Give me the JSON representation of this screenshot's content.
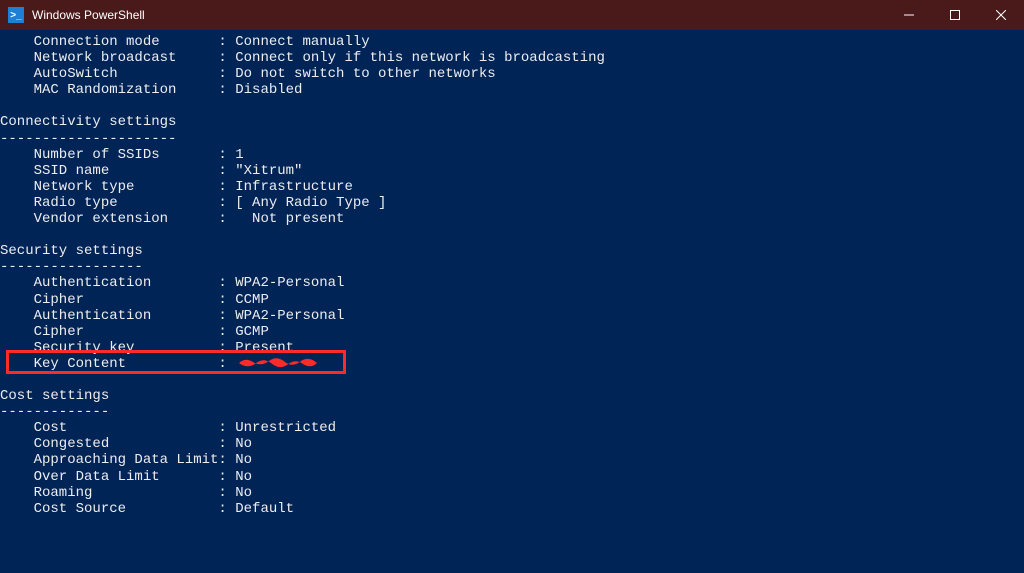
{
  "window": {
    "title": "Windows PowerShell",
    "icon_label": "powershell-icon"
  },
  "sections": {
    "top": [
      {
        "label": "Connection mode",
        "value": "Connect manually"
      },
      {
        "label": "Network broadcast",
        "value": "Connect only if this network is broadcasting"
      },
      {
        "label": "AutoSwitch",
        "value": "Do not switch to other networks"
      },
      {
        "label": "MAC Randomization",
        "value": "Disabled"
      }
    ],
    "connectivity_title": "Connectivity settings",
    "connectivity_dashes": "---------------------",
    "connectivity": [
      {
        "label": "Number of SSIDs",
        "value": "1"
      },
      {
        "label": "SSID name",
        "value": "\"Xitrum\""
      },
      {
        "label": "Network type",
        "value": "Infrastructure"
      },
      {
        "label": "Radio type",
        "value": "[ Any Radio Type ]"
      },
      {
        "label": "Vendor extension",
        "value": "Not present",
        "extra_value_pad": true
      }
    ],
    "security_title": "Security settings",
    "security_dashes": "-----------------",
    "security": [
      {
        "label": "Authentication",
        "value": "WPA2-Personal"
      },
      {
        "label": "Cipher",
        "value": "CCMP"
      },
      {
        "label": "Authentication",
        "value": "WPA2-Personal"
      },
      {
        "label": "Cipher",
        "value": "GCMP"
      },
      {
        "label": "Security key",
        "value": "Present"
      },
      {
        "label": "Key Content",
        "value": "",
        "redacted": true
      }
    ],
    "cost_title": "Cost settings",
    "cost_dashes": "-------------",
    "cost": [
      {
        "label": "Cost",
        "value": "Unrestricted"
      },
      {
        "label": "Congested",
        "value": "No"
      },
      {
        "label": "Approaching Data Limit",
        "value": "No"
      },
      {
        "label": "Over Data Limit",
        "value": "No"
      },
      {
        "label": "Roaming",
        "value": "No"
      },
      {
        "label": "Cost Source",
        "value": "Default"
      }
    ]
  },
  "layout": {
    "label_col_width_chars": 22,
    "indent_spaces": 4
  }
}
